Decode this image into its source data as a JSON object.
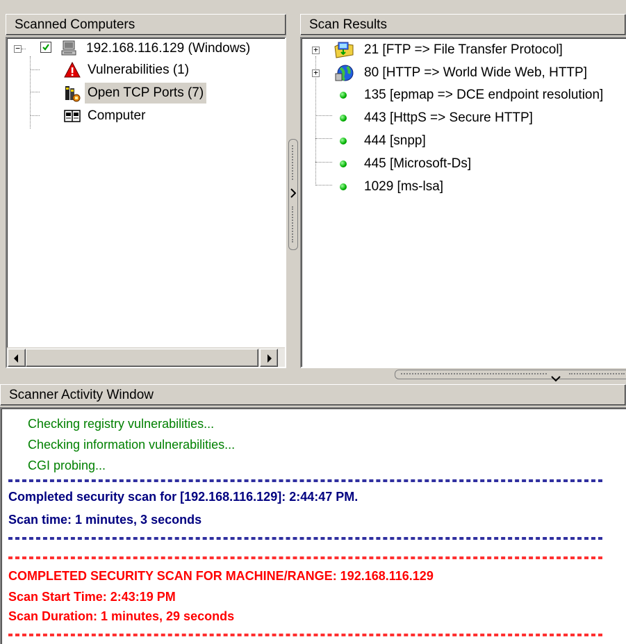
{
  "panels": {
    "computers_header": "Scanned Computers",
    "results_header": "Scan Results",
    "activity_header": "Scanner Activity Window"
  },
  "computers_tree": {
    "root": {
      "label": "192.168.116.129 (Windows)",
      "checked": true,
      "icon": "computer-icon"
    },
    "children": [
      {
        "label": "Vulnerabilities (1)",
        "icon": "warning-icon"
      },
      {
        "label": "Open TCP Ports (7)",
        "icon": "ports-icon",
        "selected": true
      },
      {
        "label": "Computer",
        "icon": "computer-info-icon"
      }
    ]
  },
  "results_tree": [
    {
      "label": "21 [FTP => File Transfer Protocol]",
      "icon": "ftp-folder-icon",
      "expandable": true
    },
    {
      "label": "80 [HTTP => World Wide Web, HTTP]",
      "icon": "globe-icon",
      "expandable": true
    },
    {
      "label": "135 [epmap => DCE endpoint resolution]",
      "icon": "green-dot-icon"
    },
    {
      "label": "443 [HttpS => Secure HTTP]",
      "icon": "green-dot-icon"
    },
    {
      "label": "444 [snpp]",
      "icon": "green-dot-icon"
    },
    {
      "label": "445 [Microsoft-Ds]",
      "icon": "green-dot-icon"
    },
    {
      "label": "1029 [ms-lsa]",
      "icon": "green-dot-icon"
    }
  ],
  "activity_log": {
    "progress_lines": [
      "Checking registry vulnerabilities...",
      "Checking information vulnerabilities...",
      "CGI probing..."
    ],
    "completed_line": "Completed security scan for [192.168.116.129]: 2:44:47 PM.",
    "scan_time": "Scan time: 1 minutes, 3 seconds",
    "summary_title": "COMPLETED SECURITY SCAN FOR MACHINE/RANGE: 192.168.116.129",
    "start_time": "Scan Start Time: 2:43:19 PM",
    "duration": "Scan Duration: 1 minutes, 29 seconds"
  },
  "colors": {
    "progress_text": "#008000",
    "completed_text": "#000080",
    "summary_text": "#ff0000"
  }
}
